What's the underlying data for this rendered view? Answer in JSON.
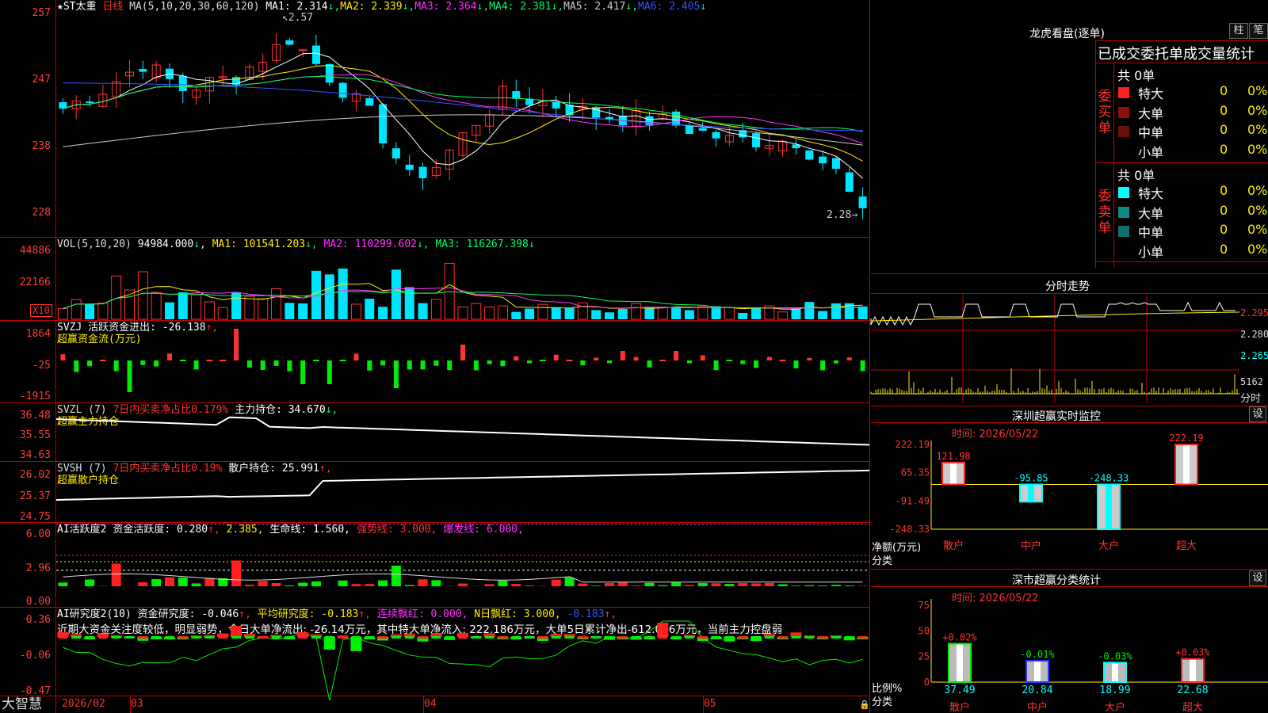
{
  "colors": {
    "up": "#ff3333",
    "down": "#00e5ff",
    "buy": "#ff2020",
    "sell": "#00ffff",
    "grid": "#c00000",
    "ma1": "#ffffff",
    "ma2": "#ffee00",
    "ma3": "#ff33ff",
    "ma4": "#00ff66",
    "ma5": "#cccccc",
    "ma6": "#3355ff"
  },
  "main": {
    "star": "★",
    "name": "ST太重",
    "period": "日线",
    "ma_params": "MA(5,10,20,30,60,120)",
    "ma_values": [
      {
        "label": "MA1:",
        "value": "2.314",
        "arrow": "↓",
        "color": "#ffffff"
      },
      {
        "label": "MA2:",
        "value": "2.339",
        "arrow": "↓",
        "color": "#ffee00"
      },
      {
        "label": "MA3:",
        "value": "2.364",
        "arrow": "↓",
        "color": "#ff33ff"
      },
      {
        "label": "MA4:",
        "value": "2.381",
        "arrow": "↓",
        "color": "#00ff66"
      },
      {
        "label": "MA5:",
        "value": "2.417",
        "arrow": "↓",
        "color": "#cccccc"
      },
      {
        "label": "MA6:",
        "value": "2.405",
        "arrow": "↓",
        "color": "#3355ff"
      }
    ],
    "yticks": [
      "257",
      "247",
      "238",
      "228"
    ],
    "high_mark": "2.57",
    "low_mark": "2.28"
  },
  "vol": {
    "params": "VOL(5,10,20)",
    "value": "94984.000",
    "arrow": "↓",
    "ma": [
      {
        "label": "MA1:",
        "value": "101541.203",
        "arrow": "↓",
        "color": "#ffee00"
      },
      {
        "label": "MA2:",
        "value": "110299.602",
        "arrow": "↓",
        "color": "#ff33ff"
      },
      {
        "label": "MA3:",
        "value": "116267.398",
        "arrow": "↓",
        "color": "#00ff66"
      }
    ],
    "yticks": [
      "44886",
      "22166"
    ],
    "unit": "X10"
  },
  "svzj": {
    "title": "SVZJ  活跃资金进出: -26.138",
    "arrow": "↑,",
    "sub": "超赢资金流(万元)",
    "yticks": [
      "1864",
      "-25",
      "-1915"
    ]
  },
  "svzl": {
    "title_a": "SVZL (7)",
    "title_b": "7日内买卖净占比0.179%",
    "title_c": "主力持仓: 34.670",
    "arrow": "↓,",
    "sub": "超赢主力持仓",
    "yticks": [
      "36.48",
      "35.55",
      "34.63"
    ]
  },
  "svsh": {
    "title_a": "SVSH (7)",
    "title_b": "7日内买卖净占比0.19%",
    "title_c": "散户持仓: 25.991",
    "arrow": "↑,",
    "sub": "超赢散户持仓",
    "yticks": [
      "26.02",
      "25.37",
      "24.75"
    ]
  },
  "ai1": {
    "title_a": "AI活跃度2",
    "title_b": "资金活跃度: 0.280",
    "a1": "↑,",
    "title_c": "2.385,",
    "title_d": "生命线: 1.560,",
    "title_e": "强势线: 3.000,",
    "title_f": "爆发线: 6.000,",
    "yticks": [
      "6.00",
      "2.96",
      "0.00"
    ]
  },
  "ai2": {
    "title_a": "AI研究度2(10)",
    "title_b": "资金研究度: -0.046",
    "a1": "↑,",
    "title_c": "平均研究度: -0.183",
    "a2": "↑,",
    "title_d": "连续飘红: 0.000,",
    "title_e": "N日飘红: 3.000,",
    "title_f": "-0.183",
    "a3": "↑,",
    "summary": "近期大资金关注度较低，明显弱势，今日大单净流出: -26.14万元，其中特大单净流入: 222.186万元，大单5日累计净出-612.056万元，当前主力控盘弱",
    "yticks": [
      "0.36",
      "-0.06",
      "-0.47"
    ]
  },
  "xaxis": {
    "labels": [
      "2026/02",
      "03",
      "04",
      "05"
    ]
  },
  "brand": "大智慧",
  "panel": {
    "header": "龙虎看盘(逐单)",
    "btn_a": "柱",
    "btn_b": "笔",
    "table_title": "已成交委托单成交量统计",
    "buy_label": "委买单",
    "sell_label": "委卖单",
    "buy_total": "共 0单",
    "sell_total": "共 0单",
    "buy_rows": [
      {
        "name": "特大",
        "color": "#ff2020",
        "n": "0",
        "p": "0%"
      },
      {
        "name": "大单",
        "color": "#8b1010",
        "n": "0",
        "p": "0%"
      },
      {
        "name": "中单",
        "color": "#6e0d0d",
        "n": "0",
        "p": "0%"
      },
      {
        "name": "小单",
        "color": "",
        "n": "0",
        "p": "0%"
      }
    ],
    "sell_rows": [
      {
        "name": "特大",
        "color": "#00ffff",
        "n": "0",
        "p": "0%"
      },
      {
        "name": "大单",
        "color": "#138888",
        "n": "0",
        "p": "0%"
      },
      {
        "name": "中单",
        "color": "#107070",
        "n": "0",
        "p": "0%"
      },
      {
        "name": "小单",
        "color": "",
        "n": "0",
        "p": "0%"
      }
    ]
  },
  "intraday": {
    "title": "分时走势",
    "yticks": [
      "2.295",
      "2.280",
      "2.265"
    ],
    "vol_label": "5162",
    "vol_unit": "分时"
  },
  "monitor": {
    "title": "深圳超赢实时监控",
    "set": "设",
    "time": "时间: 2026/05/22",
    "ylabel": "净额(万元)",
    "xlabel": "分类",
    "yticks": [
      "222.19",
      "65.35",
      "-91.49",
      "-248.33"
    ],
    "cats": [
      "散户",
      "中户",
      "大户",
      "超大"
    ],
    "values": [
      121.98,
      -95.85,
      -248.33,
      222.19
    ],
    "labels": [
      "121.98",
      "-95.85",
      "-248.33",
      "222.19"
    ]
  },
  "classify": {
    "title": "深市超赢分类统计",
    "set": "设",
    "time": "时间: 2026/05/22",
    "ylabel": "比例%",
    "xlabel": "分类",
    "yticks": [
      "75",
      "50",
      "25",
      "0"
    ],
    "cats": [
      "散户",
      "中户",
      "大户",
      "超大"
    ],
    "values": [
      37.49,
      20.84,
      18.99,
      22.68
    ],
    "labels": [
      "37.49",
      "20.84",
      "18.99",
      "22.68"
    ],
    "changes": [
      "+0.02%",
      "-0.01%",
      "-0.03%",
      "+0.03%"
    ]
  }
}
